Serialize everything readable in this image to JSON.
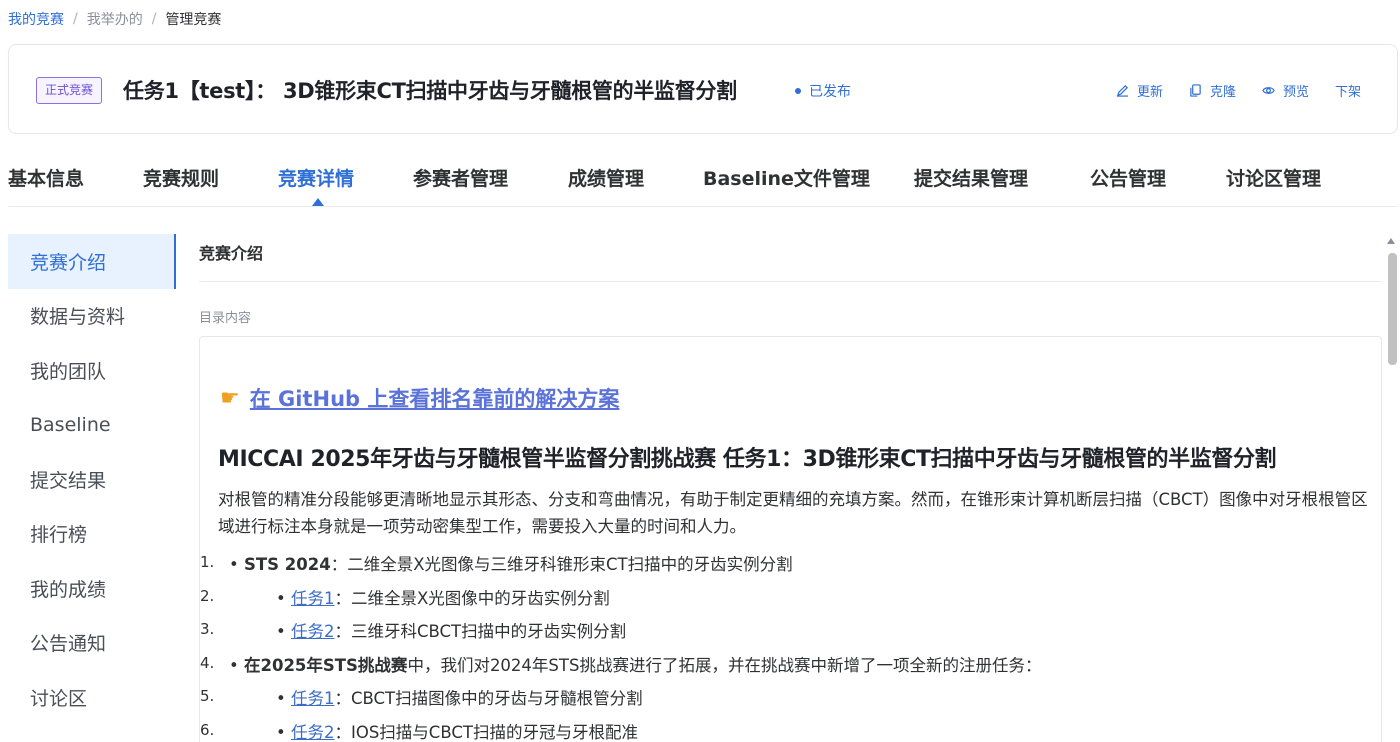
{
  "breadcrumb": {
    "level1": "我的竞赛",
    "level2": "我举办的",
    "level3": "管理竞赛",
    "separator": "/"
  },
  "header": {
    "badge": "正式竞赛",
    "title": "任务1【test】： 3D锥形束CT扫描中牙齿与牙髓根管的半监督分割",
    "status": "已发布",
    "actions": {
      "update": "更新",
      "clone": "克隆",
      "preview": "预览",
      "unpublish": "下架"
    }
  },
  "tabs": [
    {
      "label": "基本信息"
    },
    {
      "label": "竞赛规则"
    },
    {
      "label": "竞赛详情"
    },
    {
      "label": "参赛者管理"
    },
    {
      "label": "成绩管理"
    },
    {
      "label": "Baseline文件管理"
    },
    {
      "label": "提交结果管理"
    },
    {
      "label": "公告管理"
    },
    {
      "label": "讨论区管理"
    }
  ],
  "active_tab": "竞赛详情",
  "sidebar": {
    "items": [
      {
        "label": "竞赛介绍"
      },
      {
        "label": "数据与资料"
      },
      {
        "label": "我的团队"
      },
      {
        "label": "Baseline"
      },
      {
        "label": "提交结果"
      },
      {
        "label": "排行榜"
      },
      {
        "label": "我的成绩"
      },
      {
        "label": "公告通知"
      },
      {
        "label": "讨论区"
      }
    ],
    "active": "竞赛介绍"
  },
  "main": {
    "section_title": "竞赛介绍",
    "sub_label": "目录内容",
    "github_link": "在 GitHub 上查看排名靠前的解决方案",
    "doc_title": "MICCAI 2025年牙齿与牙髓根管半监督分割挑战赛 任务1：3D锥形束CT扫描中牙齿与牙髓根管的半监督分割",
    "intro": "对根管的精准分段能够更清晰地显示其形态、分支和弯曲情况，有助于制定更精细的充填方案。然而，在锥形束计算机断层扫描（CBCT）图像中对牙根根管区域进行标注本身就是一项劳动密集型工作，需要投入大量的时间和人力。",
    "list": [
      {
        "num": "1.",
        "bullet": "•",
        "bold": "STS 2024",
        "text": "：二维全景X光图像与三维牙科锥形束CT扫描中的牙齿实例分割"
      },
      {
        "num": "2.",
        "bullet": "•",
        "link": "任务1",
        "text": "：二维全景X光图像中的牙齿实例分割"
      },
      {
        "num": "3.",
        "bullet": "•",
        "link": "任务2",
        "text": "：三维牙科CBCT扫描中的牙齿实例分割"
      },
      {
        "num": "4.",
        "bullet": "•",
        "bold": "在2025年STS挑战赛",
        "text": "中，我们对2024年STS挑战赛进行了拓展，并在挑战赛中新增了一项全新的注册任务："
      },
      {
        "num": "5.",
        "bullet": "•",
        "link": "任务1",
        "text": "：CBCT扫描图像中的牙齿与牙髓根管分割"
      },
      {
        "num": "6.",
        "bullet": "•",
        "link": "任务2",
        "text": "：IOS扫描与CBCT扫描的牙冠与牙根配准"
      }
    ]
  },
  "colors": {
    "accent": "#2f6fd6",
    "badge": "#6c4fd0",
    "github_link": "#5b73d8",
    "active_bg": "#e8f1fe"
  }
}
